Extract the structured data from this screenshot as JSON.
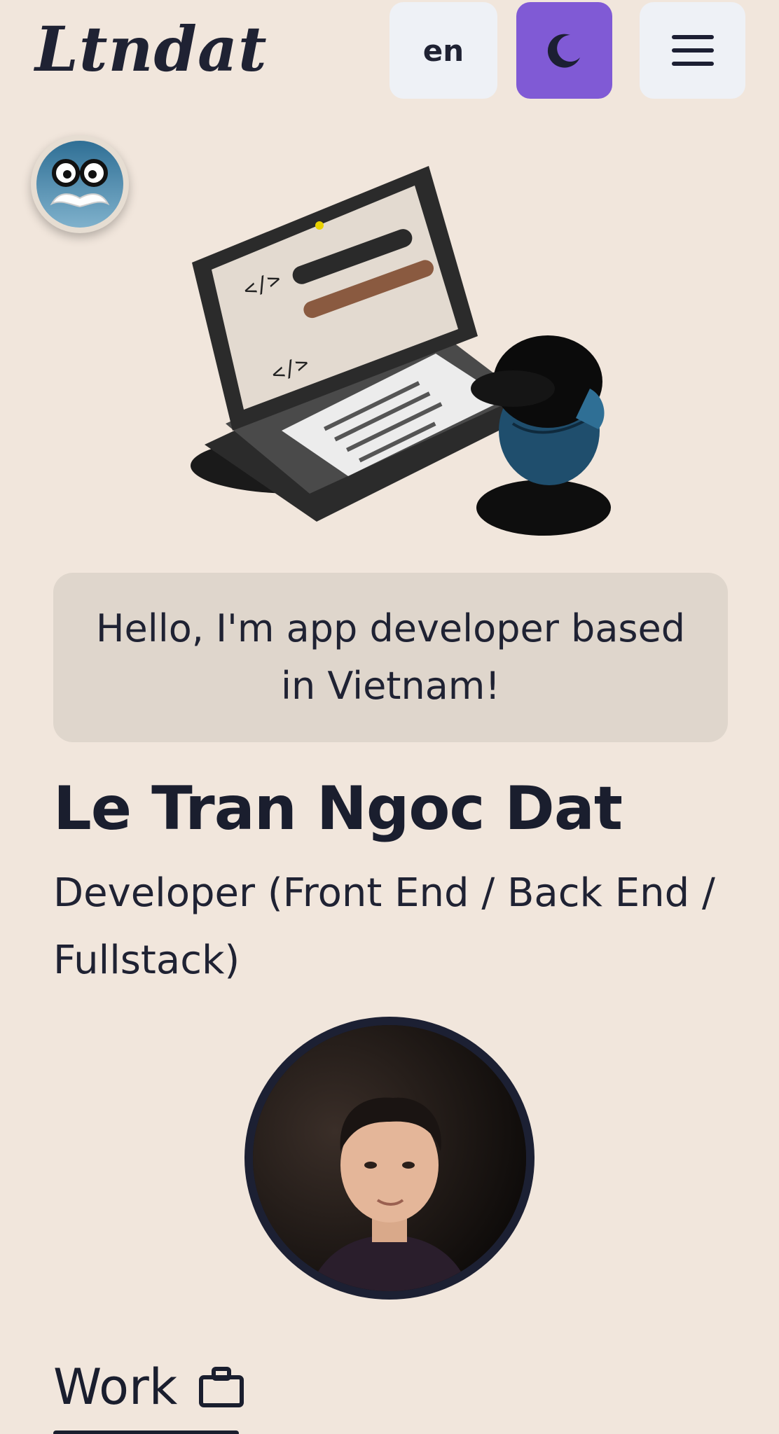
{
  "header": {
    "logo_text": "Ltndat",
    "language_label": "en",
    "theme_toggle_icon": "moon-icon",
    "menu_icon": "hamburger-menu-icon",
    "accent_color": "#805ad5"
  },
  "greeting": "Hello, I'm app developer based in Vietnam!",
  "profile": {
    "name": "Le Tran Ngoc Dat",
    "role": "Developer (Front End / Back End / Fullstack)"
  },
  "section": {
    "work_label": "Work",
    "work_icon": "briefcase-icon"
  },
  "colors": {
    "background": "#f1e6dc",
    "text": "#1f2233",
    "greeting_bg": "#dfd6cc"
  }
}
